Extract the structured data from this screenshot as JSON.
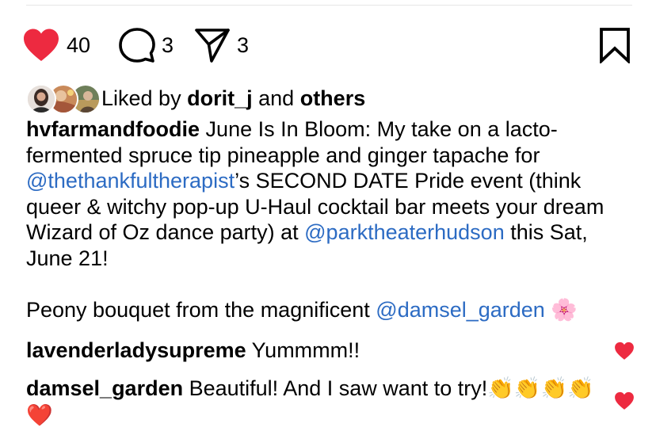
{
  "actions": {
    "like_count": "40",
    "comment_count": "3",
    "share_count": "3",
    "colors": {
      "like": "#ed2a40",
      "icon": "#000000"
    }
  },
  "likes": {
    "prefix": "Liked by",
    "first_user": "dorit_j",
    "connector": "and",
    "others": "others"
  },
  "caption": {
    "username": "hvfarmandfoodie",
    "text_1": "June Is In Bloom: My take on a lacto-fermented spruce tip pineapple and ginger tapache for ",
    "mention_1": "@thethankfultherapist",
    "text_2": "’s SECOND DATE Pride event (think queer & witchy pop-up U-Haul cocktail bar meets your dream Wizard of Oz dance party) at ",
    "mention_2": "@parktheaterhudson",
    "text_3": " this Sat, June 21!\n\nPeony bouquet from the magnificent ",
    "mention_3": "@damsel_garden",
    "text_4": " 🌸"
  },
  "comments": [
    {
      "username": "lavenderladysupreme",
      "text": "Yummmm!!"
    },
    {
      "username": "damsel_garden",
      "text": "Beautiful! And I saw want to try!👏👏👏👏❤️"
    }
  ],
  "colors": {
    "mention": "#2c6bc3",
    "heart": "#ed2a40"
  }
}
